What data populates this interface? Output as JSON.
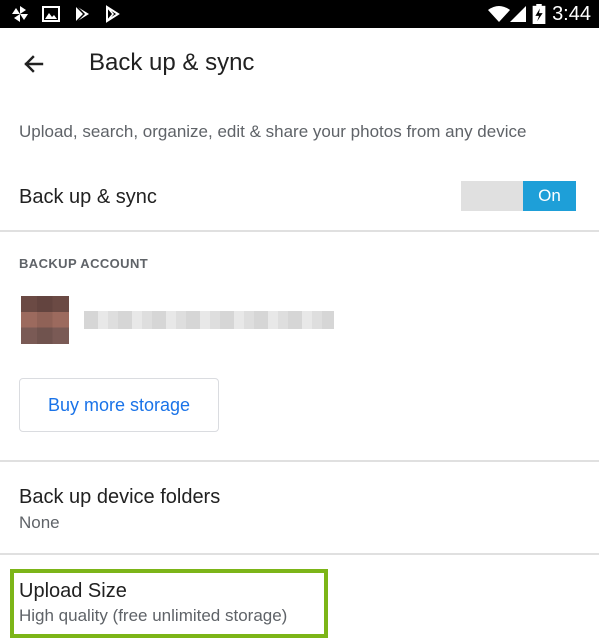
{
  "status_bar": {
    "time": "3:44",
    "left_icons": [
      "pinwheel-icon",
      "image-icon",
      "play-store-icon",
      "play-icon"
    ],
    "right_icons": [
      "wifi-icon",
      "signal-icon",
      "battery-charging-icon"
    ]
  },
  "toolbar": {
    "back_icon": "arrow-back-icon",
    "title": "Back up & sync"
  },
  "description": "Upload, search, organize, edit & share your photos from any device",
  "backup_sync": {
    "label": "Back up & sync",
    "toggle_state": "On"
  },
  "backup_account": {
    "header": "BACKUP ACCOUNT"
  },
  "buy_storage": {
    "label": "Buy more storage"
  },
  "device_folders": {
    "label": "Back up device folders",
    "value": "None"
  },
  "upload_size": {
    "label": "Upload Size",
    "value": "High quality (free unlimited storage)"
  },
  "colors": {
    "toggle_on": "#1e9fd8",
    "link_blue": "#1a73e8",
    "highlight_green": "#7cb518"
  }
}
